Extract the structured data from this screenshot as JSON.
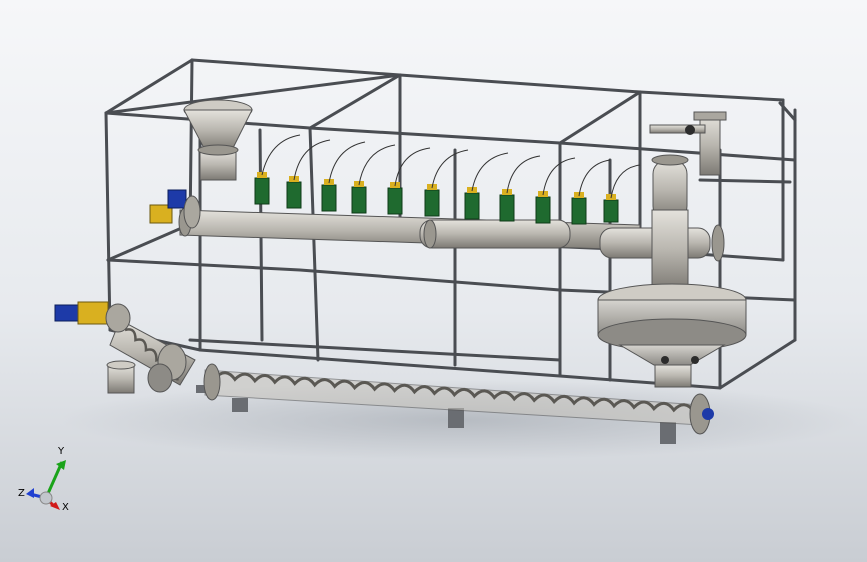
{
  "viewport": {
    "background_top": "#f6f7f9",
    "background_bottom": "#c9cdd3"
  },
  "triad": {
    "x_label": "X",
    "y_label": "Y",
    "z_label": "Z",
    "x_color": "#d11a1a",
    "y_color": "#19a319",
    "z_color": "#1f3fd1"
  },
  "colors": {
    "frame": "#4a4d52",
    "pipe": "#b8b5ae",
    "valve": "#1f6a2f",
    "motor_blue": "#1d3aa8",
    "motor_yellow": "#d9b020"
  }
}
